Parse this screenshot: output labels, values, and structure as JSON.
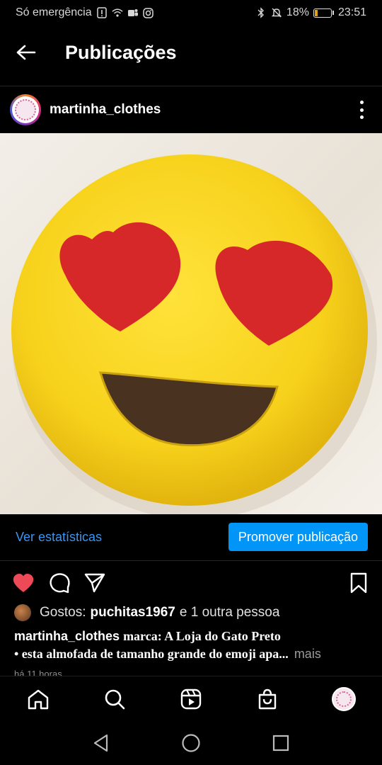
{
  "status_bar": {
    "carrier_text": "Só emergência",
    "battery_percent": "18%",
    "battery_level": 0.18,
    "time": "23:51"
  },
  "app_bar": {
    "title": "Publicações"
  },
  "post": {
    "username": "martinha_clothes",
    "stats_link": "Ver estatísticas",
    "promote_button": "Promover publicação",
    "likes": {
      "label": "Gostos:",
      "user": "puchitas1967",
      "rest": "e 1 outra pessoa"
    },
    "caption": {
      "user": "martinha_clothes",
      "line1": "marca: A Loja do Gato Preto",
      "line2": "• esta almofada de tamanho grande do emoji apa...",
      "more": "mais"
    },
    "time_ago": "há 11 horas",
    "liked": true
  },
  "colors": {
    "accent": "#0095f6",
    "link": "#3b95f0",
    "like": "#ed4956",
    "emoji_yellow": "#f7d21c",
    "heart_red": "#d62828",
    "mouth_brown": "#4a3220"
  },
  "icons": {
    "back": "arrow-left-icon",
    "more": "more-vertical-icon",
    "like": "heart-icon",
    "comment": "comment-icon",
    "share": "send-icon",
    "save": "bookmark-icon",
    "home": "home-icon",
    "search": "search-icon",
    "reels": "reels-icon",
    "shop": "shop-icon"
  }
}
